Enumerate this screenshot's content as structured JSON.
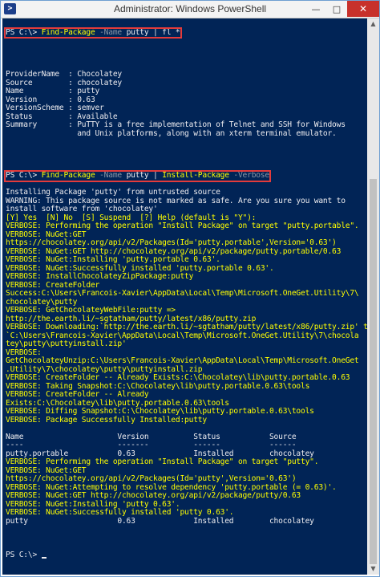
{
  "window": {
    "title": "Administrator: Windows PowerShell"
  },
  "controls": {
    "minimize": "—",
    "maximize": "□",
    "close": "✕"
  },
  "icons": {
    "app": "powershell-icon"
  },
  "colors": {
    "console_bg": "#012456",
    "text": "#eeedf0",
    "warning": "#ffff00",
    "param": "#8a96a6",
    "highlight": "#e33b3b"
  },
  "cmd1": {
    "prompt": "PS C:\\> ",
    "cmdlet": "Find-Package",
    "param": " -Name",
    "rest": " putty | fl *"
  },
  "cmd2": {
    "prompt": "PS C:\\> ",
    "cmdlet": "Find-Package",
    "param": " -Name",
    "middle": " putty | ",
    "cmdlet2": "Install-Package",
    "param2": " -Verbose"
  },
  "final_prompt": "PS C:\\> ",
  "properties": [
    "ProviderName  : Chocolatey",
    "Source        : chocolatey",
    "Name          : putty",
    "Version       : 0.63",
    "VersionScheme : semver",
    "Status        : Available",
    "Summary       : PuTTY is a free implementation of Telnet and SSH for Windows",
    "                and Unix platforms, along with an xterm terminal emulator."
  ],
  "install_output": [
    {
      "text": "Installing Package 'putty' from untrusted source",
      "color": "white"
    },
    {
      "text": "WARNING: This package source is not marked as safe. Are you sure you want to",
      "color": "white"
    },
    {
      "text": "install software from 'chocolatey'",
      "color": "white"
    },
    {
      "text": "[Y] Yes  [N] No  [S] Suspend  [?] Help (default is \"Y\"):",
      "color": "yellow"
    },
    {
      "text": "VERBOSE: Performing the operation \"Install Package\" on target \"putty.portable\".",
      "color": "yellow"
    },
    {
      "text": "VERBOSE: NuGet:GET",
      "color": "yellow"
    },
    {
      "text": "https://chocolatey.org/api/v2/Packages(Id='putty.portable',Version='0.63')",
      "color": "yellow"
    },
    {
      "text": "VERBOSE: NuGet:GET http://chocolatey.org/api/v2/package/putty.portable/0.63",
      "color": "yellow"
    },
    {
      "text": "VERBOSE: NuGet:Installing 'putty.portable 0.63'.",
      "color": "yellow"
    },
    {
      "text": "VERBOSE: NuGet:Successfully installed 'putty.portable 0.63'.",
      "color": "yellow"
    },
    {
      "text": "VERBOSE: InstallChocolateyZipPackage:putty",
      "color": "yellow"
    },
    {
      "text": "VERBOSE: CreateFolder",
      "color": "yellow"
    },
    {
      "text": "Success:C:\\Users\\Francois-Xavier\\AppData\\Local\\Temp\\Microsoft.OneGet.Utility\\7\\",
      "color": "yellow"
    },
    {
      "text": "chocolatey\\putty",
      "color": "yellow"
    },
    {
      "text": "VERBOSE: GetChocolateyWebFile:putty =>",
      "color": "yellow"
    },
    {
      "text": "http://the.earth.li/~sgtatham/putty/latest/x86/putty.zip",
      "color": "yellow"
    },
    {
      "text": "VERBOSE: Downloading:`http://the.earth.li/~sgtatham/putty/latest/x86/putty.zip' to",
      "color": "yellow"
    },
    {
      "text": "`C:\\Users\\Francois-Xavier\\AppData\\Local\\Temp\\Microsoft.OneGet.Utility\\7\\chocola",
      "color": "yellow"
    },
    {
      "text": "tey\\putty\\puttyinstall.zip'",
      "color": "yellow"
    },
    {
      "text": "VERBOSE:",
      "color": "yellow"
    },
    {
      "text": "GetChocolateyUnzip:C:\\Users\\Francois-Xavier\\AppData\\Local\\Temp\\Microsoft.OneGet",
      "color": "yellow"
    },
    {
      "text": ".Utility\\7\\chocolatey\\putty\\puttyinstall.zip",
      "color": "yellow"
    },
    {
      "text": "VERBOSE: CreateFolder -- Already Exists:C:\\Chocolatey\\lib\\putty.portable.0.63",
      "color": "yellow"
    },
    {
      "text": "VERBOSE: Taking Snapshot:C:\\Chocolatey\\lib\\putty.portable.0.63\\tools",
      "color": "yellow"
    },
    {
      "text": "VERBOSE: CreateFolder -- Already",
      "color": "yellow"
    },
    {
      "text": "Exists:C:\\Chocolatey\\lib\\putty.portable.0.63\\tools",
      "color": "yellow"
    },
    {
      "text": "VERBOSE: Diffing Snapshot:C:\\Chocolatey\\lib\\putty.portable.0.63\\tools",
      "color": "yellow"
    },
    {
      "text": "VERBOSE: Package Successfully Installed:putty",
      "color": "yellow"
    }
  ],
  "table": {
    "header": "Name                     Version          Status           Source",
    "separator": "----                     -------          ------           ------",
    "row1": "putty.portable           0.63             Installed        chocolatey",
    "row2": "putty                    0.63             Installed        chocolatey"
  },
  "second_output": [
    "VERBOSE: Performing the operation \"Install Package\" on target \"putty\".",
    "VERBOSE: NuGet:GET",
    "https://chocolatey.org/api/v2/Packages(Id='putty',Version='0.63')",
    "VERBOSE: NuGet:Attempting to resolve dependency 'putty.portable (= 0.63)'.",
    "VERBOSE: NuGet:GET http://chocolatey.org/api/v2/package/putty/0.63",
    "VERBOSE: NuGet:Installing 'putty 0.63'.",
    "VERBOSE: NuGet:Successfully installed 'putty 0.63'."
  ]
}
